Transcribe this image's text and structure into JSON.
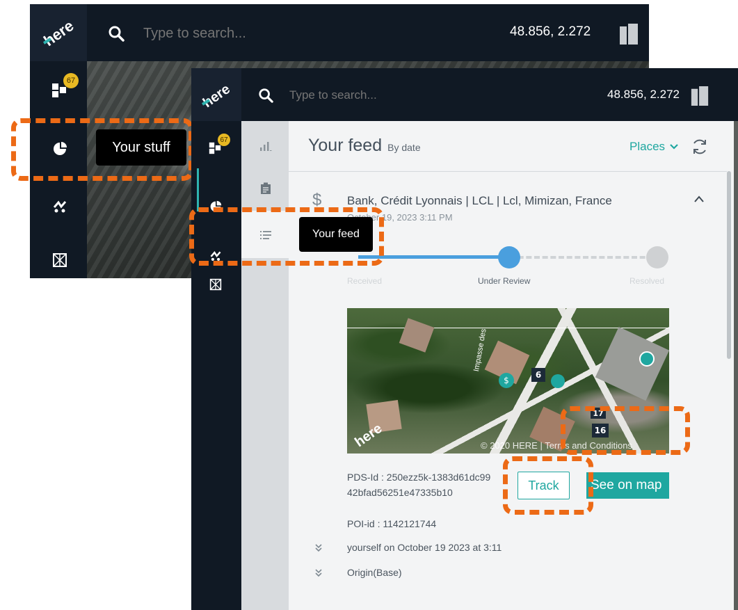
{
  "back_window": {
    "search_placeholder": "Type to search...",
    "coordinates": "48.856, 2.272",
    "badge_count": "67",
    "tooltip": "Your stuff",
    "icons": [
      "here-logo-icon",
      "search-icon",
      "layers-icon",
      "dashboard-icon",
      "pie-chart-icon",
      "traffic-icon",
      "map-grid-icon"
    ]
  },
  "front_window": {
    "search_placeholder": "Type to search...",
    "coordinates": "48.856, 2.272",
    "badge_count": "67",
    "tooltip": "Your feed",
    "sub_rail_icons": [
      "bar-chart-icon",
      "clipboard-icon",
      "list-icon"
    ],
    "panel": {
      "title": "Your feed",
      "subtitle": "By date",
      "filter_label": "Places",
      "feed_item": {
        "category_icon": "$",
        "title": "Bank, Crédit Lyonnais | LCL | Lcl, Mimizan, France",
        "date": "October 19, 2023 3:11 PM",
        "progress": {
          "steps": [
            "Received",
            "Under Review",
            "Resolved"
          ],
          "current_step": "Under Review"
        },
        "map": {
          "street_label": "Impasse des",
          "house_numbers": [
            "6",
            "17",
            "16"
          ],
          "copyright": "© 2020 HERE | Terms and Conditions",
          "logo": "here"
        },
        "pds_id_line1": "PDS-Id : 250ezz5k-1383d61dc99",
        "pds_id_line2": "42bfad56251e47335b10",
        "poi_id": "POI-id : 1142121744",
        "track_label": "Track",
        "see_on_map_label": "See on map",
        "history": [
          "yourself on October 19 2023 at 3:11",
          "Origin(Base)"
        ]
      }
    }
  },
  "colors": {
    "accent_teal": "#1fa7a0",
    "highlight_orange": "#ec6a16",
    "progress_blue": "#4a9fde",
    "badge_yellow": "#e8b923",
    "nav_dark": "#101924"
  }
}
